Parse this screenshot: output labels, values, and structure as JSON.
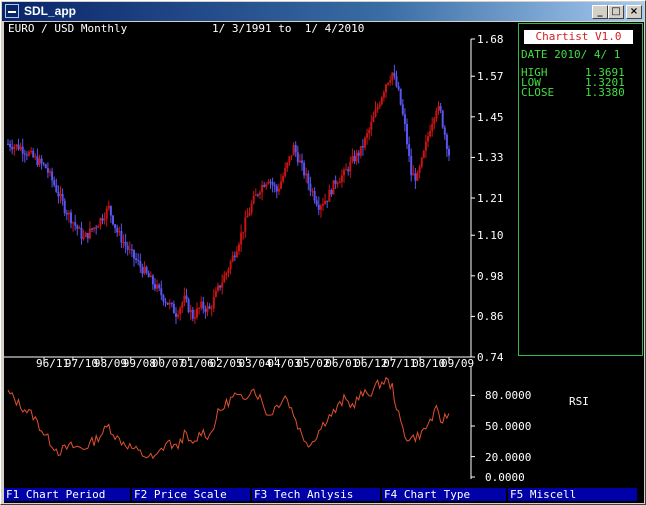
{
  "window": {
    "title": "SDL_app",
    "buttons": {
      "minimize": "_",
      "maximize": "□",
      "close": "×"
    }
  },
  "header": {
    "instrument": "EURO / USD Monthly",
    "date_range": "1/ 3/1991 to  1/ 4/2010"
  },
  "side_panel": {
    "title": "Chartist V1.0",
    "date_line": "DATE 2010/ 4/ 1",
    "high_label": "HIGH",
    "high_value": "1.3691",
    "low_label": "LOW",
    "low_value": "1.3201",
    "close_label": "CLOSE",
    "close_value": "1.3380"
  },
  "price_axis": {
    "ticks": [
      "1.68",
      "1.57",
      "1.45",
      "1.33",
      "1.21",
      "1.10",
      "0.98",
      "0.86",
      "0.74"
    ]
  },
  "time_axis": {
    "labels": [
      "96/11",
      "97/10",
      "98/09",
      "99/08",
      "00/07",
      "01/06",
      "02/05",
      "03/04",
      "04/03",
      "05/02",
      "06/01",
      "06/12",
      "07/11",
      "08/10",
      "09/09"
    ]
  },
  "rsi_axis": {
    "label": "RSI",
    "ticks": [
      "80.0000",
      "50.0000",
      "20.0000",
      "0.0000"
    ]
  },
  "colors": {
    "up": "#c81414",
    "down": "#5a55f0",
    "rsi_line": "#e05030",
    "axis": "#ffffff",
    "panel_border": "#2dbd4d",
    "fkey_bg": "#0000a8"
  },
  "function_keys": [
    {
      "label": "F1 Chart Period"
    },
    {
      "label": "F2 Price Scale"
    },
    {
      "label": "F3 Tech Anlysis"
    },
    {
      "label": "F4 Chart Type"
    },
    {
      "label": "F5 Miscell"
    }
  ],
  "chart_data": [
    {
      "type": "candlestick",
      "title": "EURO / USD Monthly",
      "ylim": [
        0.74,
        1.68
      ],
      "y_ticks": [
        1.68,
        1.57,
        1.45,
        1.33,
        1.21,
        1.1,
        0.98,
        0.86,
        0.74
      ],
      "x_tick_labels": [
        "96/11",
        "97/10",
        "98/09",
        "99/08",
        "00/07",
        "01/06",
        "02/05",
        "03/04",
        "04/03",
        "05/02",
        "06/01",
        "06/12",
        "07/11",
        "08/10",
        "09/09"
      ],
      "close_path": [
        [
          0,
          1.37
        ],
        [
          6,
          1.36
        ],
        [
          12,
          1.33
        ],
        [
          18,
          1.3
        ],
        [
          22,
          1.25
        ],
        [
          27,
          1.18
        ],
        [
          32,
          1.13
        ],
        [
          36,
          1.09
        ],
        [
          42,
          1.13
        ],
        [
          48,
          1.18
        ],
        [
          52,
          1.11
        ],
        [
          58,
          1.05
        ],
        [
          64,
          1.0
        ],
        [
          70,
          0.95
        ],
        [
          76,
          0.9
        ],
        [
          80,
          0.87
        ],
        [
          84,
          0.91
        ],
        [
          88,
          0.86
        ],
        [
          92,
          0.89
        ],
        [
          96,
          0.88
        ],
        [
          100,
          0.94
        ],
        [
          104,
          0.99
        ],
        [
          108,
          1.05
        ],
        [
          112,
          1.12
        ],
        [
          116,
          1.19
        ],
        [
          120,
          1.24
        ],
        [
          124,
          1.27
        ],
        [
          128,
          1.23
        ],
        [
          132,
          1.29
        ],
        [
          136,
          1.36
        ],
        [
          140,
          1.3
        ],
        [
          144,
          1.24
        ],
        [
          148,
          1.19
        ],
        [
          152,
          1.21
        ],
        [
          156,
          1.26
        ],
        [
          160,
          1.28
        ],
        [
          164,
          1.32
        ],
        [
          168,
          1.35
        ],
        [
          172,
          1.41
        ],
        [
          176,
          1.48
        ],
        [
          180,
          1.55
        ],
        [
          183,
          1.58
        ],
        [
          186,
          1.52
        ],
        [
          189,
          1.42
        ],
        [
          192,
          1.28
        ],
        [
          195,
          1.27
        ],
        [
          198,
          1.34
        ],
        [
          201,
          1.42
        ],
        [
          204,
          1.48
        ],
        [
          206,
          1.46
        ],
        [
          208,
          1.4
        ],
        [
          210,
          1.34
        ]
      ],
      "last": {
        "date": "2010/4/1",
        "high": 1.3691,
        "low": 1.3201,
        "close": 1.338
      }
    },
    {
      "type": "line",
      "title": "RSI",
      "ylim": [
        0,
        100
      ],
      "y_ticks": [
        80,
        50,
        20,
        0
      ],
      "values": [
        [
          0,
          83
        ],
        [
          6,
          70
        ],
        [
          12,
          60
        ],
        [
          18,
          40
        ],
        [
          24,
          25
        ],
        [
          30,
          30
        ],
        [
          36,
          28
        ],
        [
          42,
          37
        ],
        [
          48,
          50
        ],
        [
          52,
          38
        ],
        [
          58,
          30
        ],
        [
          64,
          22
        ],
        [
          70,
          18
        ],
        [
          76,
          35
        ],
        [
          80,
          28
        ],
        [
          84,
          42
        ],
        [
          88,
          30
        ],
        [
          92,
          45
        ],
        [
          96,
          40
        ],
        [
          100,
          62
        ],
        [
          104,
          72
        ],
        [
          108,
          80
        ],
        [
          112,
          75
        ],
        [
          116,
          88
        ],
        [
          120,
          78
        ],
        [
          124,
          60
        ],
        [
          128,
          70
        ],
        [
          132,
          80
        ],
        [
          136,
          62
        ],
        [
          140,
          40
        ],
        [
          144,
          32
        ],
        [
          148,
          45
        ],
        [
          152,
          58
        ],
        [
          156,
          65
        ],
        [
          160,
          76
        ],
        [
          164,
          70
        ],
        [
          168,
          80
        ],
        [
          172,
          82
        ],
        [
          176,
          90
        ],
        [
          180,
          95
        ],
        [
          183,
          88
        ],
        [
          186,
          60
        ],
        [
          189,
          40
        ],
        [
          192,
          38
        ],
        [
          195,
          40
        ],
        [
          198,
          45
        ],
        [
          201,
          55
        ],
        [
          204,
          65
        ],
        [
          206,
          55
        ],
        [
          208,
          58
        ],
        [
          210,
          62
        ]
      ]
    }
  ]
}
